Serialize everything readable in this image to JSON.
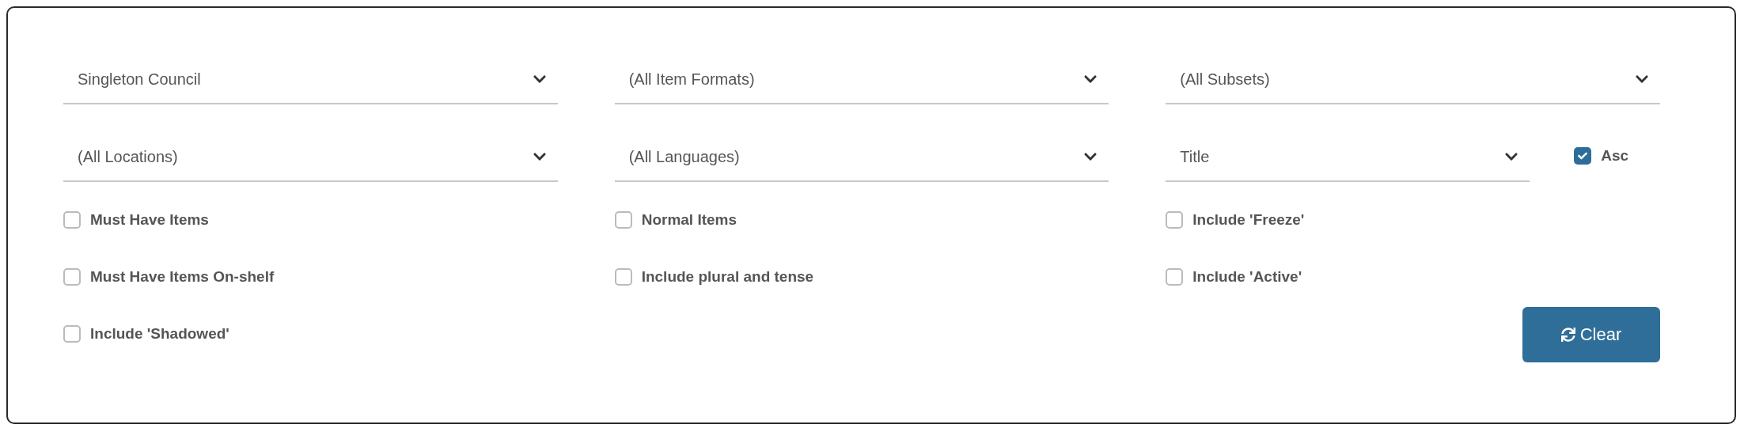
{
  "dropdowns": [
    {
      "value": "Singleton Council"
    },
    {
      "value": "(All Item Formats)"
    },
    {
      "value": "(All Subsets)"
    },
    {
      "value": "(All Locations)"
    },
    {
      "value": "(All Languages)"
    },
    {
      "value": "Title"
    }
  ],
  "sort_order": {
    "label": "Asc",
    "checked": true
  },
  "checkboxes": [
    {
      "label": "Must Have Items",
      "checked": false
    },
    {
      "label": "Normal Items",
      "checked": false
    },
    {
      "label": "Include 'Freeze'",
      "checked": false
    },
    {
      "label": "Must Have Items On-shelf",
      "checked": false
    },
    {
      "label": "Include plural and tense",
      "checked": false
    },
    {
      "label": "Include 'Active'",
      "checked": false
    },
    {
      "label": "Include 'Shadowed'",
      "checked": false
    }
  ],
  "clear_button": {
    "label": "Clear"
  }
}
